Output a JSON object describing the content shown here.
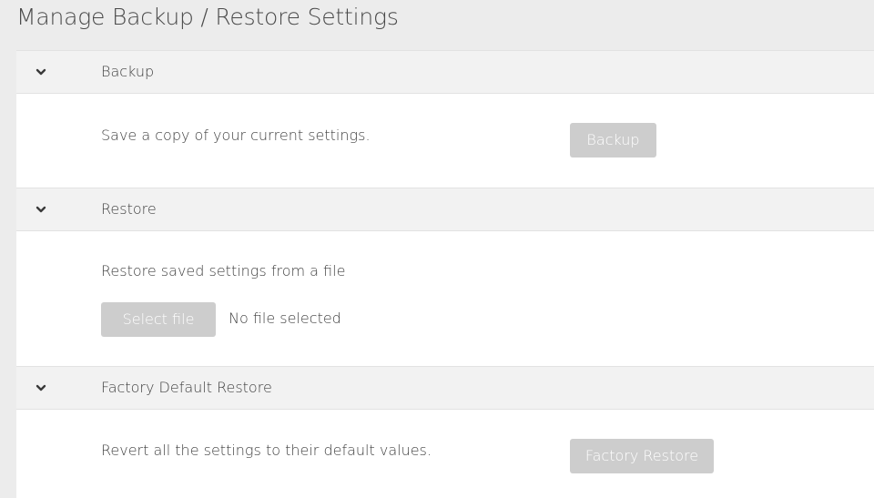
{
  "page": {
    "title": "Manage Backup / Restore Settings"
  },
  "sections": {
    "backup": {
      "title": "Backup",
      "description": "Save a copy of your current settings.",
      "button_label": "Backup"
    },
    "restore": {
      "title": "Restore",
      "description": "Restore saved settings from a file",
      "select_button_label": "Select file",
      "file_status": "No file selected"
    },
    "factory": {
      "title": "Factory Default Restore",
      "description": "Revert all the settings to their default values.",
      "button_label": "Factory Restore"
    }
  },
  "icons": {
    "section_toggle": "chevron-down-icon"
  },
  "colors": {
    "page_background": "#ececec",
    "section_header_background": "#f2f2f2",
    "content_background": "#ffffff",
    "disabled_button": "#cdcdcd",
    "text": "#404040"
  }
}
